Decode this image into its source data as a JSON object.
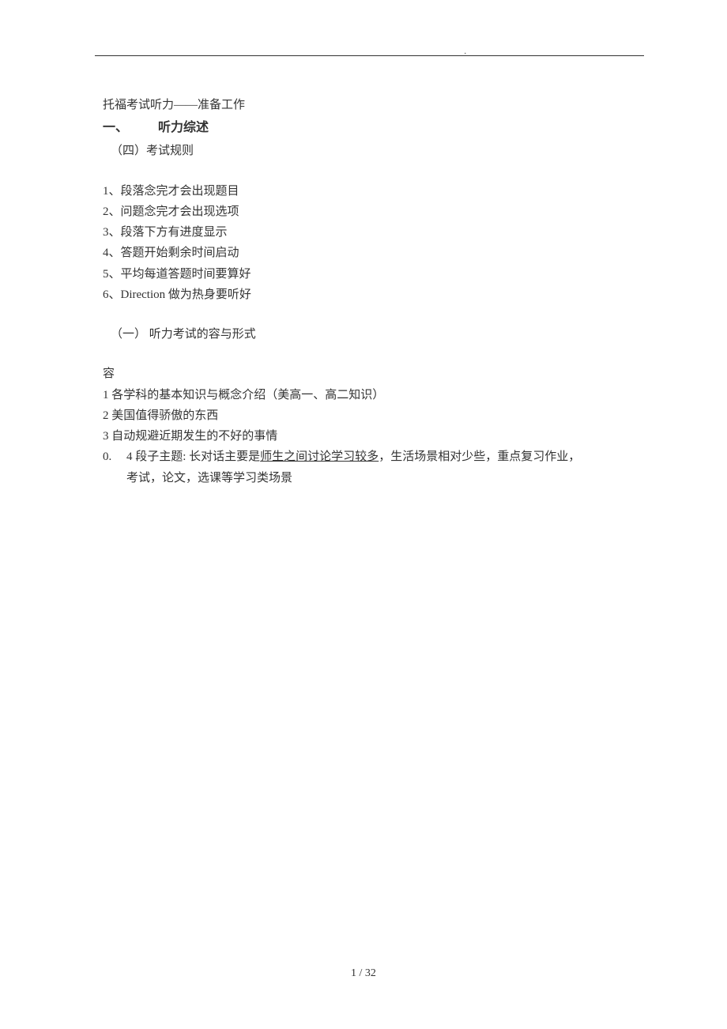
{
  "topDot": ".",
  "title": "托福考试听力——准备工作",
  "heading": {
    "number": "一、",
    "text": "听力综述"
  },
  "subheading4": "（四）考试规则",
  "rules": [
    "1、段落念完才会出现题目",
    "2、问题念完才会出现选项",
    "3、段落下方有进度显示",
    "4、答题开始剩余时间启动",
    "5、平均每道答题时间要算好",
    "6、Direction 做为热身要听好"
  ],
  "subheading1": "（一） 听力考试的容与形式",
  "contentLabel": "容",
  "contentItems": [
    "1 各学科的基本知识与概念介绍（美高一、高二知识）",
    "2 美国值得骄傲的东西",
    "3 自动规避近期发生的不好的事情"
  ],
  "item4": {
    "num": "0.",
    "prefix": "4 段子主题: 长对话主要是",
    "underlined": "师生之间讨论学习较多",
    "suffix": "，生活场景相对少些，重点复习作业，",
    "line2": "考试，论文，选课等学习类场景"
  },
  "pageNumber": "1 / 32"
}
